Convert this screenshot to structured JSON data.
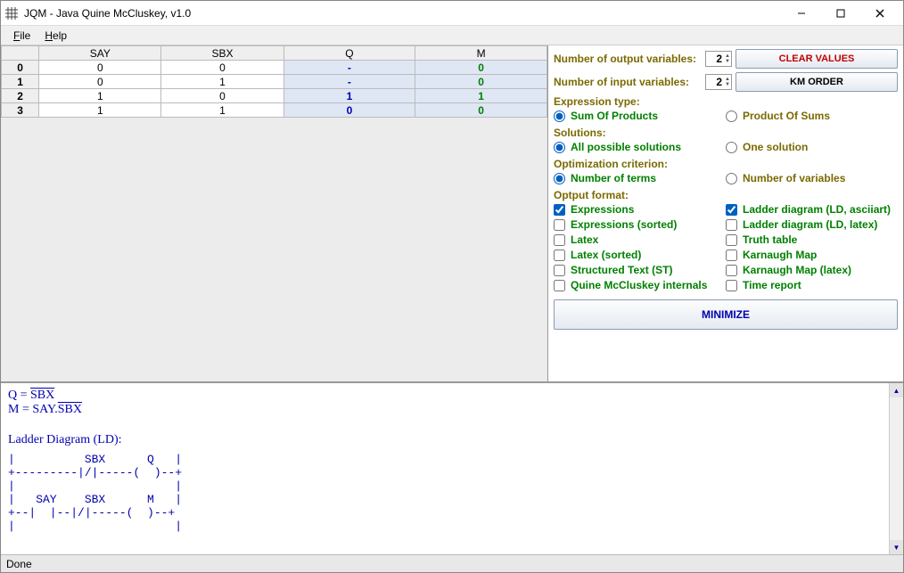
{
  "window": {
    "title": "JQM - Java Quine McCluskey, v1.0"
  },
  "menu": {
    "file": "File",
    "help": "Help"
  },
  "table": {
    "headers": [
      "SAY",
      "SBX",
      "Q",
      "M"
    ],
    "rows": [
      {
        "idx": "0",
        "say": "0",
        "sbx": "0",
        "q": "-",
        "m": "0"
      },
      {
        "idx": "1",
        "say": "0",
        "sbx": "1",
        "q": "-",
        "m": "0"
      },
      {
        "idx": "2",
        "say": "1",
        "sbx": "0",
        "q": "1",
        "m": "1"
      },
      {
        "idx": "3",
        "say": "1",
        "sbx": "1",
        "q": "0",
        "m": "0"
      }
    ]
  },
  "side": {
    "out_label": "Number of output variables:",
    "out_val": "2",
    "in_label": "Number of  input  variables:",
    "in_val": "2",
    "clear_btn": "CLEAR VALUES",
    "km_btn": "KM ORDER",
    "expr_type_label": "Expression type:",
    "sop": "Sum Of Products",
    "pos": "Product Of Sums",
    "solutions_label": "Solutions:",
    "all_sol": "All possible solutions",
    "one_sol": "One solution",
    "opt_label": "Optimization criterion:",
    "num_terms": "Number of terms",
    "num_vars": "Number of variables",
    "out_format_label": "Optput format:",
    "fmt": {
      "expressions": "Expressions",
      "ladder_ascii": "Ladder diagram (LD, asciiart)",
      "expressions_sorted": "Expressions (sorted)",
      "ladder_latex": "Ladder diagram (LD, latex)",
      "latex": "Latex",
      "truth_table": "Truth table",
      "latex_sorted": "Latex (sorted)",
      "kmap": "Karnaugh Map",
      "st": "Structured Text (ST)",
      "kmap_latex": "Karnaugh Map (latex)",
      "qmi": "Quine McCluskey internals",
      "time": "Time report"
    },
    "minimize": "MINIMIZE"
  },
  "output": {
    "heading": "Ladder Diagram (LD):",
    "ladder": "|          SBX      Q   |\n+---------|/|-----(  )--+\n|                       |\n|   SAY    SBX      M   |\n+--|  |--|/|-----(  )--+\n|                       |"
  },
  "status": "Done"
}
